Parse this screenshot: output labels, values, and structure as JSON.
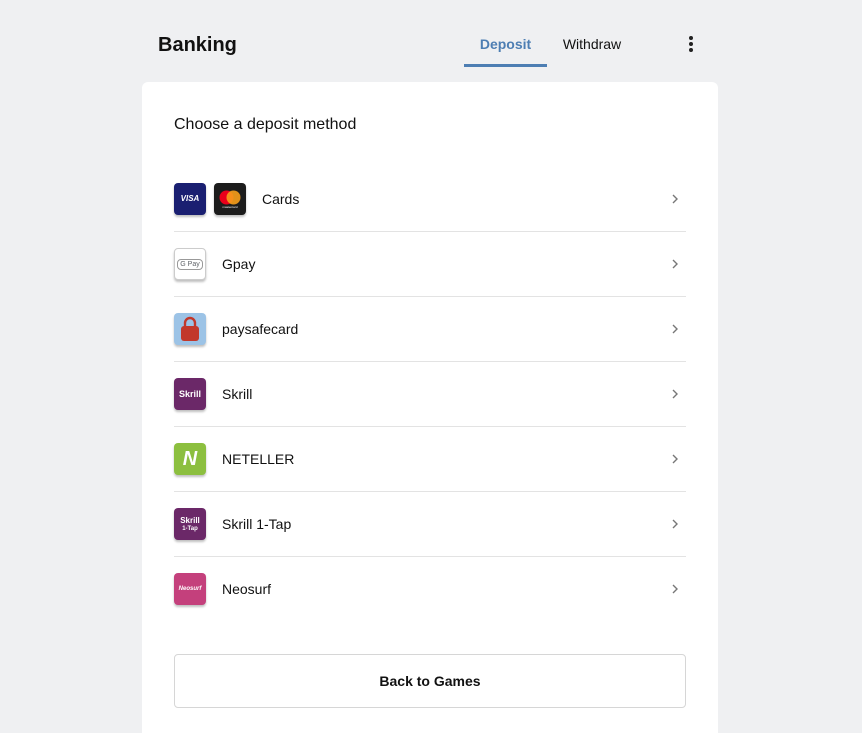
{
  "header": {
    "title": "Banking",
    "tabs": [
      {
        "label": "Deposit",
        "active": true
      },
      {
        "label": "Withdraw",
        "active": false
      }
    ]
  },
  "main": {
    "subtitle": "Choose a deposit method",
    "methods": [
      {
        "label": "Cards",
        "icons": [
          "visa-logo",
          "mastercard-logo"
        ]
      },
      {
        "label": "Gpay",
        "icons": [
          "gpay-logo"
        ]
      },
      {
        "label": "paysafecard",
        "icons": [
          "paysafecard-logo"
        ]
      },
      {
        "label": "Skrill",
        "icons": [
          "skrill-logo"
        ]
      },
      {
        "label": "NETELLER",
        "icons": [
          "neteller-logo"
        ]
      },
      {
        "label": "Skrill 1-Tap",
        "icons": [
          "skrill-1tap-logo"
        ]
      },
      {
        "label": "Neosurf",
        "icons": [
          "neosurf-logo"
        ]
      }
    ],
    "back_button": "Back to Games"
  },
  "logo_text": {
    "visa": "VISA",
    "mastercard": "mastercard",
    "gpay": "G Pay",
    "skrill": "Skrill",
    "neteller": "N",
    "skrill_1tap_line1": "Skrill",
    "skrill_1tap_line2": "1-Tap",
    "neosurf": "Neosurf"
  },
  "colors": {
    "accent": "#4d7eb3",
    "background": "#eff0f2",
    "visa": "#1a1f71",
    "mastercard": "#1c1c1c",
    "paysafecard": "#9cc3e6",
    "skrill": "#6b2868",
    "neteller": "#8cbf3f",
    "neosurf": "#c4407c"
  }
}
